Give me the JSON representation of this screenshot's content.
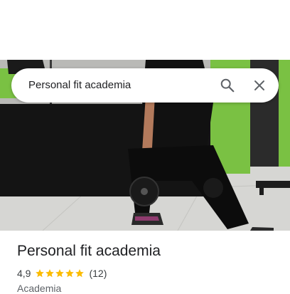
{
  "search": {
    "query": "Personal fit academia",
    "search_icon": "search-icon",
    "close_icon": "close-icon"
  },
  "photo": {
    "description_icon": "place-photo"
  },
  "place": {
    "name": "Personal fit academia",
    "rating": "4,9",
    "stars": 5,
    "review_count": "(12)",
    "category": "Academia"
  },
  "colors": {
    "star": "#fbbc04",
    "text_primary": "#202124",
    "text_secondary": "#5f6368",
    "wall_green": "#7ac143"
  }
}
